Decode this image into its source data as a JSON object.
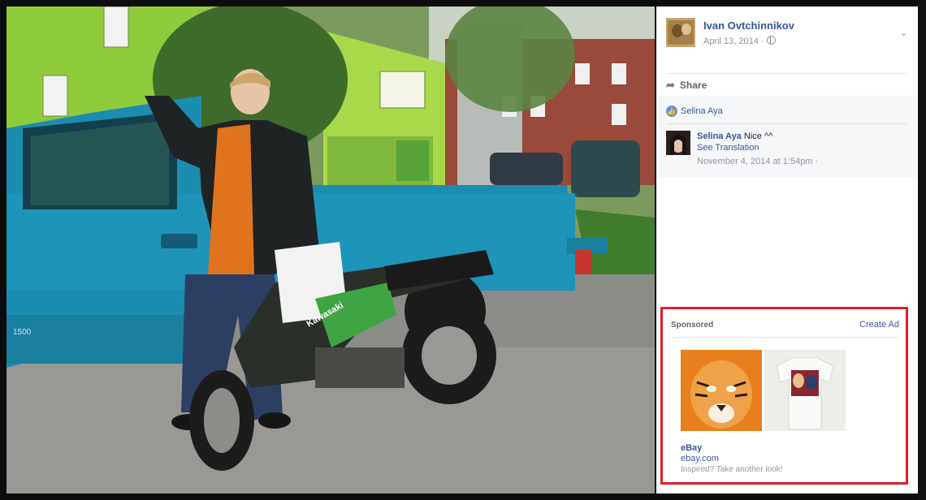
{
  "post": {
    "author": "Ivan Ovtchinnikov",
    "date": "April 13, 2014 ·",
    "share_label": "Share",
    "likes": {
      "liker": "Selina Aya"
    },
    "comments": [
      {
        "name": "Selina Aya",
        "text": "Nice ^^",
        "translate_label": "See Translation",
        "time": "November 4, 2014 at 1:54pm ·"
      }
    ]
  },
  "photo": {
    "truck_badge": "1500",
    "bike_brand": "Kawasaki"
  },
  "ad": {
    "sponsored_label": "Sponsored",
    "create_label": "Create Ad",
    "title": "eBay",
    "domain": "ebay.com",
    "description": "Inspired? Take another look!"
  },
  "colors": {
    "link": "#365899",
    "ad_border": "#e01e2b",
    "meta_text": "#90949c"
  },
  "icons": {
    "share": "share-arrow-icon",
    "like": "like-thumb-icon",
    "privacy": "globe-icon",
    "menu": "chevron-down-icon"
  }
}
